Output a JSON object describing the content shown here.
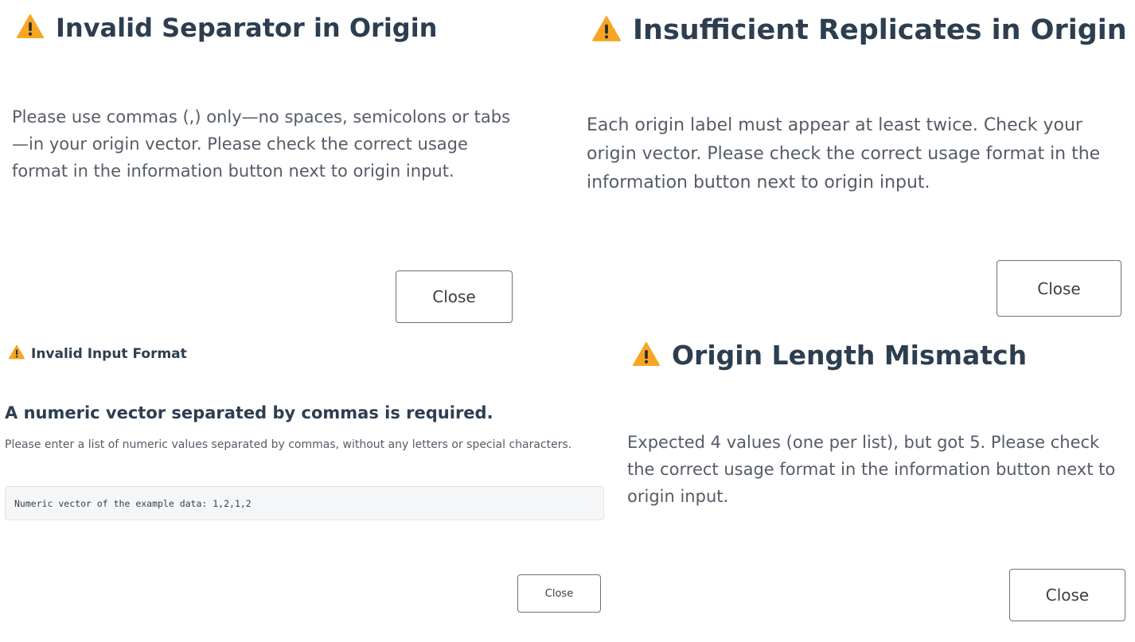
{
  "colors": {
    "warning_fill": "#f6a623",
    "warning_mark": "#2b2b2b",
    "title_text": "#2c3e50",
    "body_text": "#555c66",
    "button_border": "#6c7178",
    "code_background": "#f5f6f7"
  },
  "dialogs": [
    {
      "icon": "warning-icon",
      "title": "Invalid Separator in Origin",
      "message": "Please use commas (,) only—no spaces, semicolons or tabs—in your origin vector. Please check the correct usage format in the information button next to origin input.",
      "close_label": "Close"
    },
    {
      "icon": "warning-icon",
      "title": "Insufficient Replicates in Origin",
      "message": "Each origin label must appear at least twice. Check your origin vector. Please check the correct usage format in the information button next to origin input.",
      "close_label": "Close"
    },
    {
      "icon": "warning-icon",
      "title": "Invalid Input Format",
      "subtitle": "A numeric vector separated by commas is required.",
      "message": "Please enter a list of numeric values separated by commas, without any letters or special characters.",
      "code_example": "Numeric vector of the example data: 1,2,1,2",
      "close_label": "Close"
    },
    {
      "icon": "warning-icon",
      "title": "Origin Length Mismatch",
      "message": "Expected 4 values (one per list), but got 5. Please check the correct usage format in the information button next to origin input.",
      "close_label": "Close"
    }
  ]
}
